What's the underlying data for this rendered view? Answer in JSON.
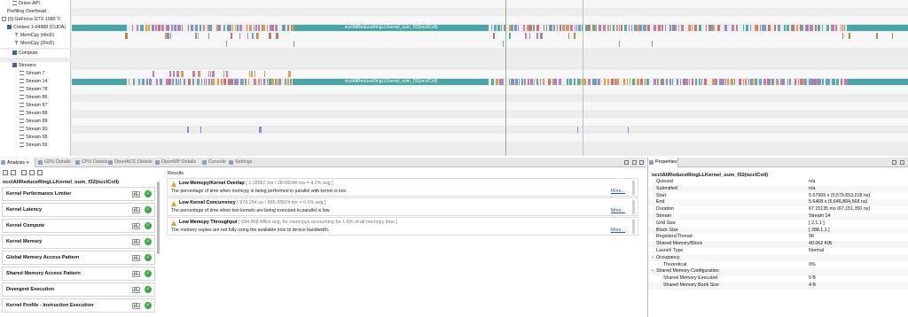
{
  "timeline": {
    "rows": [
      {
        "id": "driver-api",
        "label": "Driver API",
        "indent": 14,
        "icon": "lines"
      },
      {
        "id": "profiling-overhead",
        "label": "Profiling Overhead",
        "indent": 8,
        "icon": "none"
      },
      {
        "id": "gpu",
        "label": "[0] GeForce GTX 1080 Ti",
        "indent": 2,
        "icon": "box"
      },
      {
        "id": "context",
        "label": "Context 1-64988 (CUDA)",
        "indent": 8,
        "icon": "minus"
      },
      {
        "id": "memcpy-htod",
        "label": "MemCpy (HtoD)",
        "indent": 16,
        "icon": "funnel"
      },
      {
        "id": "memcpy-dtod",
        "label": "MemCpy (DtoD)",
        "indent": 16,
        "icon": "funnel"
      },
      {
        "id": "compute",
        "label": "Compute",
        "indent": 14,
        "icon": "plus"
      },
      {
        "id": "streams",
        "label": "Streams",
        "indent": 14,
        "icon": "minus"
      },
      {
        "id": "stream-7",
        "label": "Stream 7",
        "indent": 22,
        "icon": "lines"
      },
      {
        "id": "stream-14",
        "label": "Stream 14",
        "indent": 22,
        "icon": "lines"
      },
      {
        "id": "stream-78",
        "label": "Stream 78",
        "indent": 22,
        "icon": "lines"
      },
      {
        "id": "stream-86",
        "label": "Stream 86",
        "indent": 22,
        "icon": "lines"
      },
      {
        "id": "stream-87",
        "label": "Stream 87",
        "indent": 22,
        "icon": "lines"
      },
      {
        "id": "stream-88",
        "label": "Stream 88",
        "indent": 22,
        "icon": "lines"
      },
      {
        "id": "stream-89",
        "label": "Stream 89",
        "indent": 22,
        "icon": "lines"
      },
      {
        "id": "stream-90",
        "label": "Stream 90",
        "indent": 22,
        "icon": "lines"
      },
      {
        "id": "stream-98",
        "label": "Stream 98",
        "indent": 22,
        "icon": "lines"
      },
      {
        "id": "stream-99",
        "label": "Stream 99",
        "indent": 22,
        "icon": "lines"
      }
    ],
    "kernel_bar_label": "ncclAllReduceRingLLKernel_sum_f32(ncclColl)",
    "colors": {
      "kernel": "#48a6a6",
      "cursor": "#7fbf7f",
      "memcpy": "#b48a3c",
      "mixed": [
        "#c77bbf",
        "#6fa0c8",
        "#e0a040",
        "#8a8ad0",
        "#4fb0a0",
        "#d07070"
      ]
    }
  },
  "tabs": [
    {
      "label": "Analysis",
      "close": "✕",
      "active": true
    },
    {
      "label": "GPU Details",
      "active": false
    },
    {
      "label": "CPU Details",
      "active": false
    },
    {
      "label": "OpenACC Details",
      "active": false
    },
    {
      "label": "OpenMP Details",
      "active": false
    },
    {
      "label": "Console",
      "active": false
    },
    {
      "label": "Settings",
      "active": false
    }
  ],
  "analysis": {
    "kernel_title": "ncclAllReduceRingLLKernel_sum_f32(ncclColl)",
    "items": [
      "Kernel Performance Limiter",
      "Kernel Latency",
      "Kernel Compute",
      "Kernel Memory",
      "Global Memory Access Pattern",
      "Shared Memory Access Pattern",
      "Divergent Execution",
      "Kernel Profile - Instruction Execution"
    ],
    "status_glyph": "✓"
  },
  "results": {
    "label": "Results",
    "more_label": "More...",
    "items": [
      {
        "title": "Low Memcpy/Kernel Overlap",
        "detail": "[ 1.18962 ms / 28.06046 ms = 4.2% avg ]",
        "desc": "The percentage of time when memcpy is being performed in parallel with kernel is low."
      },
      {
        "title": "Low Kernel Concurrency",
        "detail": "[ 879.254 µs / 885.33874 ms = 0.1% avg ]",
        "desc": "The percentage of time when two kernels are being executed in parallel is low."
      },
      {
        "title": "Low Memcpy Throughput",
        "detail": "[ 634.868 MB/s avg, for memcpys accounting for 1.6% of all memcpy time ]",
        "desc": "The memory copies are not fully using the available host to device bandwidth."
      }
    ]
  },
  "properties": {
    "tab_label": "Properties",
    "title": "ncclAllReduceRingLLKernel_sum_f32(ncclColl)",
    "rows": [
      {
        "k": "Queued",
        "v": "n/a",
        "level": 1
      },
      {
        "k": "Submitted",
        "v": "n/a",
        "level": 1
      },
      {
        "k": "Start",
        "v": "5.57965 s (5,579,653,218 ns)",
        "level": 1
      },
      {
        "k": "End",
        "v": "5.6468 s (5,646,804,568 ns)",
        "level": 1
      },
      {
        "k": "Duration",
        "v": "67.15135 ms (67,151,350 ns)",
        "level": 1
      },
      {
        "k": "Stream",
        "v": "Stream 14",
        "level": 1
      },
      {
        "k": "Grid Size",
        "v": "[ 2,1,1 ]",
        "level": 1
      },
      {
        "k": "Block Size",
        "v": "[ 288,1,1 ]",
        "level": 1
      },
      {
        "k": "Registers/Thread",
        "v": "96",
        "level": 1
      },
      {
        "k": "Shared Memory/Block",
        "v": "40.062 KiB",
        "level": 1
      },
      {
        "k": "Launch Type",
        "v": "Normal",
        "level": 1
      },
      {
        "k": "Occupancy",
        "v": "",
        "level": 0,
        "section": true
      },
      {
        "k": "Theoretical",
        "v": "0%",
        "level": 2
      },
      {
        "k": "Shared Memory Configuration",
        "v": "",
        "level": 0,
        "section": true
      },
      {
        "k": "Shared Memory Executed",
        "v": "0 B",
        "level": 2
      },
      {
        "k": "Shared Memory Bank Size",
        "v": "4 B",
        "level": 2
      }
    ]
  }
}
